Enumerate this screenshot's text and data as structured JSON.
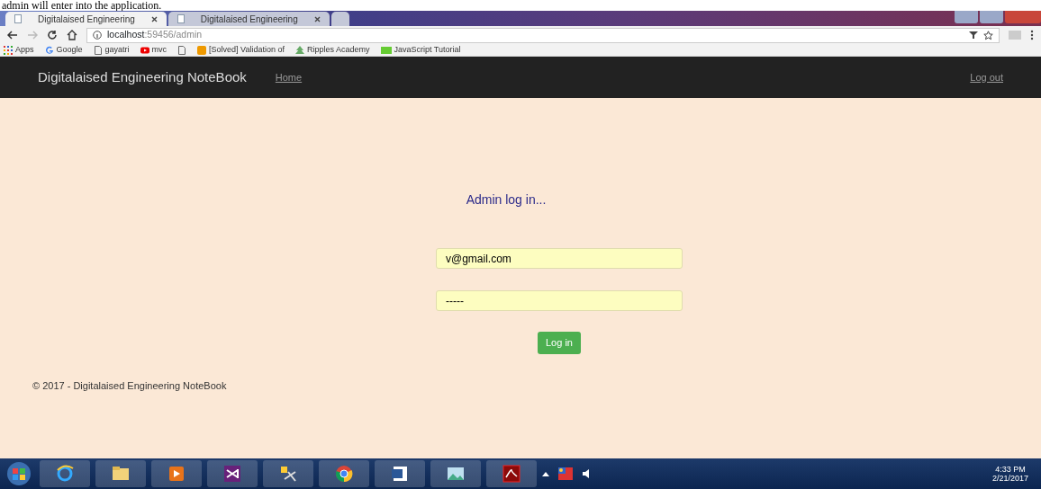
{
  "document_caption": "admin will enter into the application.",
  "browser": {
    "tabs": [
      {
        "title": "Digitalaised Engineering",
        "selected": true
      },
      {
        "title": "Digitalaised Engineering",
        "selected": false
      }
    ],
    "address": {
      "host": "localhost",
      "rest": ":59456/admin"
    },
    "bookmarks": [
      {
        "kind": "apps",
        "label": "Apps"
      },
      {
        "kind": "google",
        "label": "Google"
      },
      {
        "kind": "page",
        "label": "gayatri"
      },
      {
        "kind": "youtube",
        "label": "mvc"
      },
      {
        "kind": "page"
      },
      {
        "kind": "site",
        "label": "[Solved] Validation of"
      },
      {
        "kind": "tree",
        "label": "Ripples Academy"
      },
      {
        "kind": "w3",
        "label": "JavaScript Tutorial"
      }
    ]
  },
  "navbar": {
    "brand": "Digitalaised Engineering NoteBook",
    "links": [
      "Home"
    ],
    "right_link": "Log out"
  },
  "login": {
    "heading": "Admin log in...",
    "email": "v@gmail.com",
    "password": "-----",
    "button": "Log in"
  },
  "footer": "© 2017 - Digitalaised Engineering NoteBook",
  "taskbar": {
    "apps": [
      {
        "kind": "ie"
      },
      {
        "kind": "explorer"
      },
      {
        "kind": "media"
      },
      {
        "kind": "vs"
      },
      {
        "kind": "tools"
      },
      {
        "kind": "chrome"
      },
      {
        "kind": "word"
      },
      {
        "kind": "photos"
      },
      {
        "kind": "acrobat"
      }
    ],
    "time": "4:33 PM",
    "date": "2/21/2017"
  }
}
